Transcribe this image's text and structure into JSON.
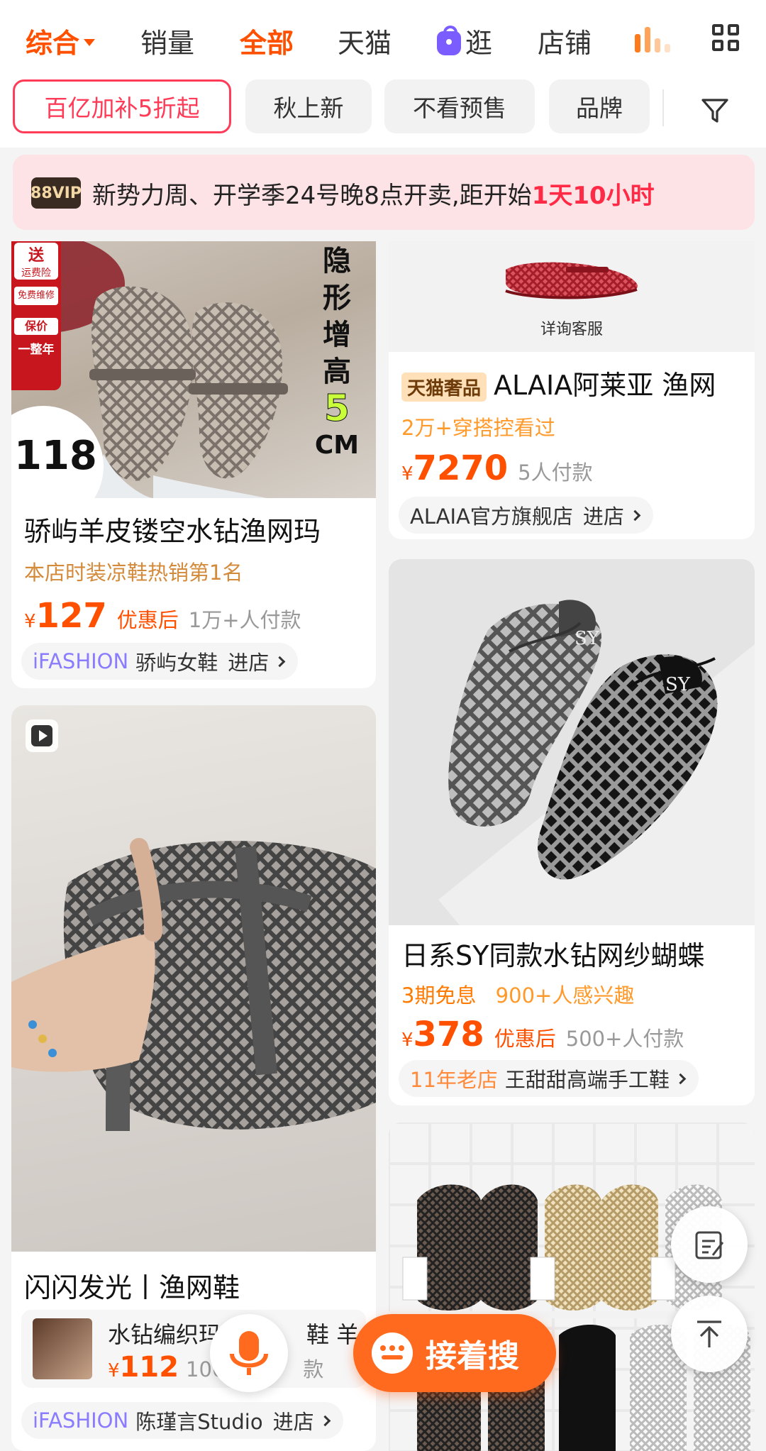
{
  "sort_bar": {
    "tabs": [
      {
        "label": "综合",
        "active": true
      },
      {
        "label": "销量"
      },
      {
        "label": "全部",
        "active": true
      },
      {
        "label": "天猫"
      },
      {
        "label": "逛",
        "icon": "shopping-bag-icon"
      },
      {
        "label": "店铺"
      }
    ]
  },
  "filters": {
    "chips": [
      "百亿加补5折起",
      "秋上新",
      "不看预售",
      "品牌"
    ]
  },
  "banner": {
    "badge": "88VIP",
    "text": "新势力周、开学季24号晚8点开卖,距开始",
    "countdown": "1天10小时"
  },
  "products": [
    {
      "overlay_labels": [
        "送",
        "运费险",
        "免费维修",
        "保价",
        "一整年"
      ],
      "overlay_price": "118",
      "overlay_side_text": "隐形增高",
      "overlay_side_number": "5",
      "overlay_side_unit": "CM",
      "title": "骄屿羊皮镂空水钻渔网玛",
      "subtitle": "本店时装凉鞋热销第1名",
      "currency": "¥",
      "price": "127",
      "after_label": "优惠后",
      "sold": "1万+人付款",
      "shop_tag": "iFASHION",
      "shop_name": "骄屿女鞋",
      "shop_enter": "进店"
    },
    {
      "image_caption": "详询客服",
      "badge": "天猫奢品",
      "title": "ALAIA阿莱亚 渔网",
      "subtitle": "2万+穿搭控看过",
      "currency": "¥",
      "price": "7270",
      "sold": "5人付款",
      "shop_name": "ALAIA官方旗舰店",
      "shop_enter": "进店"
    },
    {
      "title": "日系SY同款水钻网纱蝴蝶",
      "subtitle_a": "3期免息",
      "subtitle_b": "900+人感兴趣",
      "currency": "¥",
      "price": "378",
      "after_label": "优惠后",
      "sold": "500+人付款",
      "shop_tag": "11年老店",
      "shop_name": "王甜甜高端手工鞋"
    },
    {
      "title": "闪闪发光丨渔网鞋",
      "related_title": "水钻编织玛",
      "related_title_end": "鞋 羊",
      "related_currency": "¥",
      "related_price": "112",
      "related_sold_a": "100",
      "related_sold_b": "款",
      "shop_tag": "iFASHION",
      "shop_name": "陈瑾言Studio",
      "shop_enter": "进店"
    }
  ],
  "actions": {
    "next_search": "接着搜"
  },
  "colors": {
    "accent": "#ff5000",
    "promo": "#ff3b58",
    "ifashion": "#8a7cff"
  }
}
